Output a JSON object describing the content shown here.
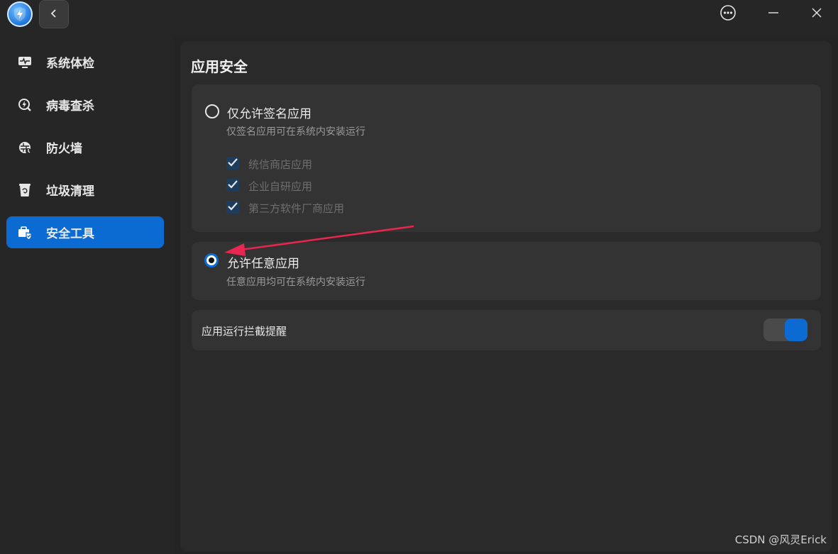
{
  "window": {
    "logo_icon": "shield-bolt-icon",
    "back_icon": "chevron-left-icon",
    "more_icon": "more-icon",
    "minimize_icon": "minimize-icon",
    "close_icon": "close-icon"
  },
  "sidebar": {
    "items": [
      {
        "label": "系统体检",
        "icon": "monitor-pulse-icon"
      },
      {
        "label": "病毒查杀",
        "icon": "virus-scan-icon"
      },
      {
        "label": "防火墙",
        "icon": "firewall-icon"
      },
      {
        "label": "垃圾清理",
        "icon": "trash-icon"
      },
      {
        "label": "安全工具",
        "icon": "toolbox-icon",
        "active": true
      }
    ]
  },
  "main": {
    "title": "应用安全",
    "option_signed": {
      "title": "仅允许签名应用",
      "description": "仅签名应用可在系统内安装运行",
      "selected": false,
      "sub_options": [
        {
          "label": "统信商店应用",
          "checked": true
        },
        {
          "label": "企业自研应用",
          "checked": true
        },
        {
          "label": "第三方软件厂商应用",
          "checked": true
        }
      ]
    },
    "option_any": {
      "title": "允许任意应用",
      "description": "任意应用均可在系统内安装运行",
      "selected": true
    },
    "intercept_toggle": {
      "label": "应用运行拦截提醒",
      "on": true
    }
  },
  "annotation": {
    "color": "#e8264f"
  },
  "watermark": "CSDN @风灵Erick",
  "colors": {
    "accent": "#0b6bd3",
    "background": "#242424",
    "card": "#333333"
  }
}
